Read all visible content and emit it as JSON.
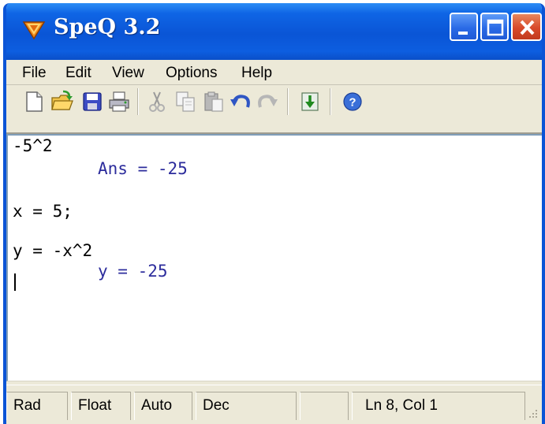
{
  "window": {
    "title": "SpeQ 3.2",
    "controls": [
      "minimize-icon",
      "maximize-icon",
      "close-icon"
    ]
  },
  "menu": {
    "items": [
      "File",
      "Edit",
      "View",
      "Options",
      "Help"
    ]
  },
  "toolbar": {
    "icons": [
      "new-file-icon",
      "open-file-icon",
      "save-icon",
      "print-icon",
      "cut-icon",
      "copy-icon",
      "paste-icon",
      "undo-icon",
      "redo-icon",
      "evaluate-icon",
      "help-icon"
    ]
  },
  "editor": {
    "lines": [
      {
        "kind": "input",
        "text": "-5^2"
      },
      {
        "kind": "output",
        "text": "Ans = -25"
      },
      {
        "kind": "input",
        "text": "x = 5;"
      },
      {
        "kind": "input",
        "text": "y = -x^2"
      },
      {
        "kind": "output",
        "text": "y = -25"
      }
    ],
    "colors": {
      "input": "#000000",
      "output": "#2c2c9c"
    }
  },
  "statusbar": {
    "angle": "Rad",
    "number_format": "Float",
    "precision": "Auto",
    "base": "Dec",
    "position": "Ln 8, Col 1"
  },
  "colors": {
    "titlebar": "#0a55d6",
    "chrome": "#ece9d8",
    "close_button": "#d8492a"
  }
}
